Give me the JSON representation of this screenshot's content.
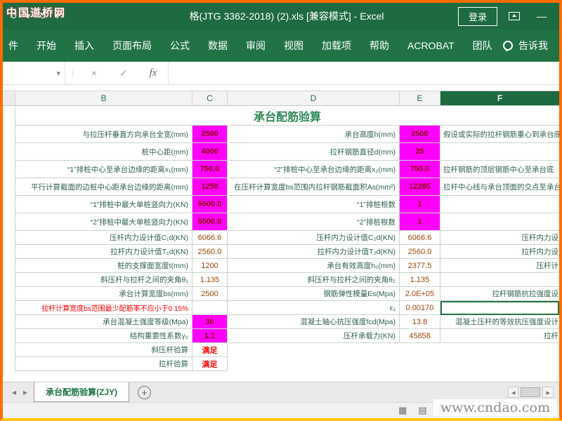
{
  "frame": {
    "watermark_top": "中国道桥网",
    "watermark_bottom": "www.cndao.com"
  },
  "titlebar": {
    "title": "格(JTG 3362-2018) (2).xls  [兼容模式]  -  Excel",
    "sign_in": "登录",
    "minimize": "—",
    "qat_icons": [
      {
        "name": "undo-icon",
        "glyph": "↺"
      },
      {
        "name": "undo-dropdown-icon",
        "glyph": "▾"
      },
      {
        "name": "redo-icon",
        "glyph": "↻"
      },
      {
        "name": "customize-quick-access-icon",
        "glyph": "▾"
      }
    ]
  },
  "ribbon": {
    "tabs": [
      "件",
      "开始",
      "插入",
      "页面布局",
      "公式",
      "数据",
      "审阅",
      "视图",
      "加载项",
      "帮助",
      "ACROBAT",
      "团队"
    ],
    "tell_me": "告诉我"
  },
  "formula_bar": {
    "name_dropdown": "▾",
    "separator": "⋮",
    "cancel": "×",
    "enter": "✓",
    "fx": "fx"
  },
  "sheet": {
    "title": "承台配筋验算",
    "columns": [
      "B",
      "C",
      "D",
      "E",
      "F"
    ],
    "selected_column": "F",
    "tab_name": "承台配筋验算(ZJY)",
    "rows": [
      {
        "b": "与拉压杆垂直方向承台全宽(mm)",
        "c": "2500",
        "c_input": true,
        "d": "承台高度h(mm)",
        "e": "2500",
        "e_input": true,
        "f": "假设或实际的拉杆钢筋重心到承台底面",
        "f_align": "left",
        "tall": true
      },
      {
        "b": "桩中心距(mm)",
        "c": "4000",
        "c_input": true,
        "d": "拉杆钢筋直径d(mm)",
        "e": "25",
        "e_input": true,
        "f": "",
        "tall": true
      },
      {
        "b": "“1”排桩中心至承台边缘的距离x₁(mm)",
        "c": "750.0",
        "c_input": true,
        "d": "“2”排桩中心至承台边缘的距离x₂(mm)",
        "e": "750.0",
        "e_input": true,
        "f": "拉杆钢筋的顶层钢筋中心至承台底",
        "f_align": "left",
        "tall": true
      },
      {
        "b": "平行计算截面的边桩中心距承台边缘的距离(mm)",
        "c": "1250",
        "c_input": true,
        "d": "在压杆计算宽度bs范围内拉杆钢筋截面积As(mm²)",
        "e": "12265",
        "e_input": true,
        "f": "拉杆中心线与承台顶面的交点至承台边缘",
        "f_align": "left",
        "tall": true
      },
      {
        "b": "“1”排桩中最大单桩竖向力(KN)",
        "c": "5500.0",
        "c_input": true,
        "d": "“1”排桩根数",
        "e": "1",
        "e_input": true,
        "f": "",
        "tall": true
      },
      {
        "b": "“2”排桩中最大单桩竖向力(KN)",
        "c": "5500.0",
        "c_input": true,
        "d": "“2”排桩根数",
        "e": "1",
        "e_input": true,
        "f": "",
        "tall": true
      },
      {
        "b": "压杆内力设计值C₁d(KN)",
        "c": "6066.6",
        "d": "压杆内力设计值C₂d(KN)",
        "e": "6066.6",
        "f": "压杆内力设",
        "f_align": "right"
      },
      {
        "b": "拉杆内力设计值T₁d(KN)",
        "c": "2560.0",
        "d": "拉杆内力设计值T₂d(KN)",
        "e": "2560.0",
        "f": "拉杆内力设",
        "f_align": "right"
      },
      {
        "b": "桩的支撑面宽度t(mm)",
        "c": "1200",
        "d": "承台有效高度h₀(mm)",
        "e": "2377.5",
        "f": "压杆计",
        "f_align": "right"
      },
      {
        "b": "斜压杆与拉杆之间的夹角θ₁",
        "c": "1.135",
        "d": "斜压杆与拉杆之间的夹角θ₂",
        "e": "1.135",
        "f": ""
      },
      {
        "b": "承台计算宽度bs(mm)",
        "c": "2500",
        "d": "钢筋弹性模量Es(Mpa)",
        "e": "2.0E+05",
        "f": "拉杆钢筋抗拉强度设",
        "f_align": "right"
      },
      {
        "b": "拉杆计算宽度bs范围最少配筋率不应小于0.15%",
        "b_red": true,
        "c": "",
        "d": "ε₁",
        "e": "0.00170",
        "f": "",
        "f_sel": true
      },
      {
        "b": "承台混凝土强度等级(Mpa)",
        "c": "30",
        "c_input": true,
        "d": "混凝土轴心抗压强度fcd(Mpa)",
        "e": "13.8",
        "f": "混凝土压杆的等效抗压强度设计",
        "f_align": "right"
      },
      {
        "b": "结构重要性系数γ₀",
        "c": "1.1",
        "c_input": true,
        "d": "压杆承载力(KN)",
        "e": "45858",
        "f": "拉杆",
        "f_align": "right"
      },
      {
        "b": "斜压杆验算",
        "c": "满足",
        "c_ok": true,
        "d": "",
        "e": "",
        "f": "",
        "blank_de": true
      },
      {
        "b": "拉杆验算",
        "c": "满足",
        "c_ok": true,
        "d": "",
        "e": "",
        "f": "",
        "blank_de": true
      }
    ]
  },
  "tabstrip": {
    "prev": "◂",
    "next": "▸",
    "add": "+"
  },
  "scrollbar": {
    "left": "◂",
    "right": "▸"
  },
  "statusbar": {
    "view_icons": [
      {
        "name": "normal-view-icon",
        "glyph": "▦"
      },
      {
        "name": "page-layout-view-icon",
        "glyph": "▤"
      },
      {
        "name": "page-break-preview-icon",
        "glyph": "▩"
      }
    ]
  },
  "colors": {
    "accent": "#217346",
    "titlebar_bg": "#1E6A41",
    "ribbon_bg": "#217346",
    "magenta": "#FF00FF",
    "input_text": "#8B0000",
    "value_text": "#A0450A",
    "label_text": "#2F6053",
    "title_text": "#2E8B57",
    "ok_text": "#FF0000",
    "warn_text": "#FF0000",
    "border_orange": "#FF6D00",
    "border_bottom_yellow": "#FFC800",
    "grid_border": "#CBD5CE",
    "header_bg": "#F3F3F3",
    "selected_header_bg": "#1E6A41"
  }
}
